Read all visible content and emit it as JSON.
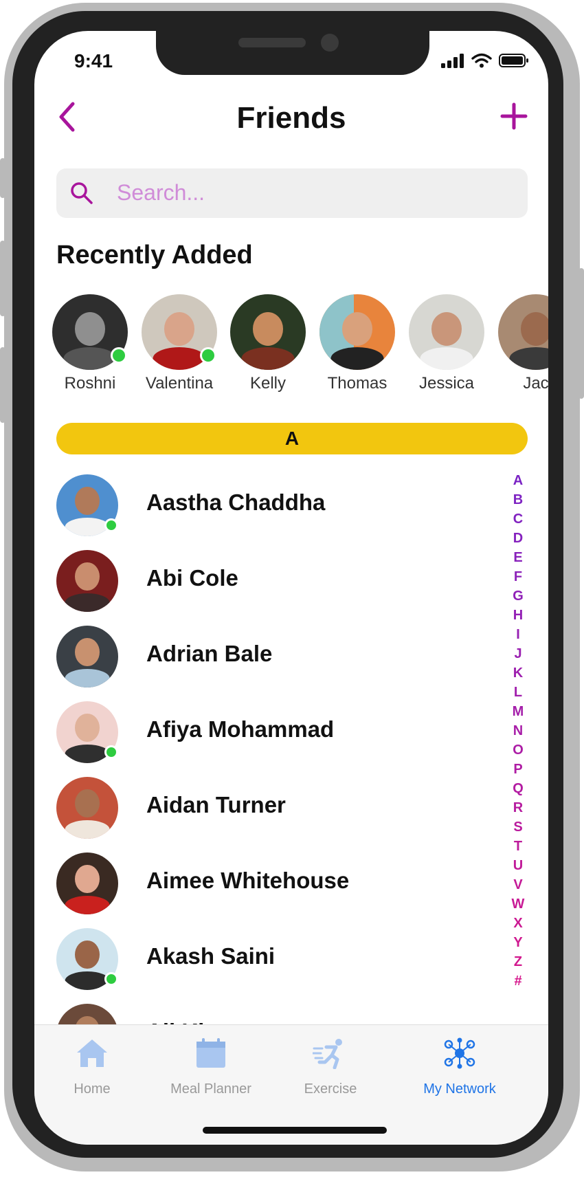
{
  "status_bar": {
    "time": "9:41",
    "signal_icon": "signal-icon",
    "wifi_icon": "wifi-icon",
    "battery_icon": "battery-icon"
  },
  "header": {
    "title": "Friends",
    "back_icon": "chevron-left-icon",
    "add_icon": "plus-icon"
  },
  "search": {
    "placeholder": "Search...",
    "value": "",
    "icon": "search-icon"
  },
  "recently_added": {
    "title": "Recently Added",
    "people": [
      {
        "name": "Roshni",
        "online": true
      },
      {
        "name": "Valentina",
        "online": true
      },
      {
        "name": "Kelly",
        "online": false
      },
      {
        "name": "Thomas",
        "online": false
      },
      {
        "name": "Jessica",
        "online": false
      },
      {
        "name": "Jac",
        "online": false
      }
    ]
  },
  "section_letter": "A",
  "friends": [
    {
      "name": "Aastha Chaddha",
      "online": true
    },
    {
      "name": "Abi Cole",
      "online": false
    },
    {
      "name": "Adrian Bale",
      "online": false
    },
    {
      "name": "Afiya Mohammad",
      "online": true
    },
    {
      "name": "Aidan Turner",
      "online": false
    },
    {
      "name": "Aimee Whitehouse",
      "online": false
    },
    {
      "name": "Akash Saini",
      "online": true
    },
    {
      "name": "Ali Kh",
      "online": false
    }
  ],
  "alphabet_index": [
    "A",
    "B",
    "C",
    "D",
    "E",
    "F",
    "G",
    "H",
    "I",
    "J",
    "K",
    "L",
    "M",
    "N",
    "O",
    "P",
    "Q",
    "R",
    "S",
    "T",
    "U",
    "V",
    "W",
    "X",
    "Y",
    "Z",
    "#"
  ],
  "tab_bar": {
    "tabs": [
      {
        "label": "Home",
        "icon": "home-icon",
        "active": false
      },
      {
        "label": "Meal Planner",
        "icon": "calendar-icon",
        "active": false
      },
      {
        "label": "Exercise",
        "icon": "running-icon",
        "active": false
      },
      {
        "label": "My Network",
        "icon": "network-icon",
        "active": true
      }
    ]
  },
  "colors": {
    "accent": "#a8159c",
    "online": "#2ecc40",
    "section_bar": "#f2c60f",
    "tab_active": "#1f74e6",
    "tab_inactive": "#999999",
    "placeholder": "#d08cd8"
  }
}
